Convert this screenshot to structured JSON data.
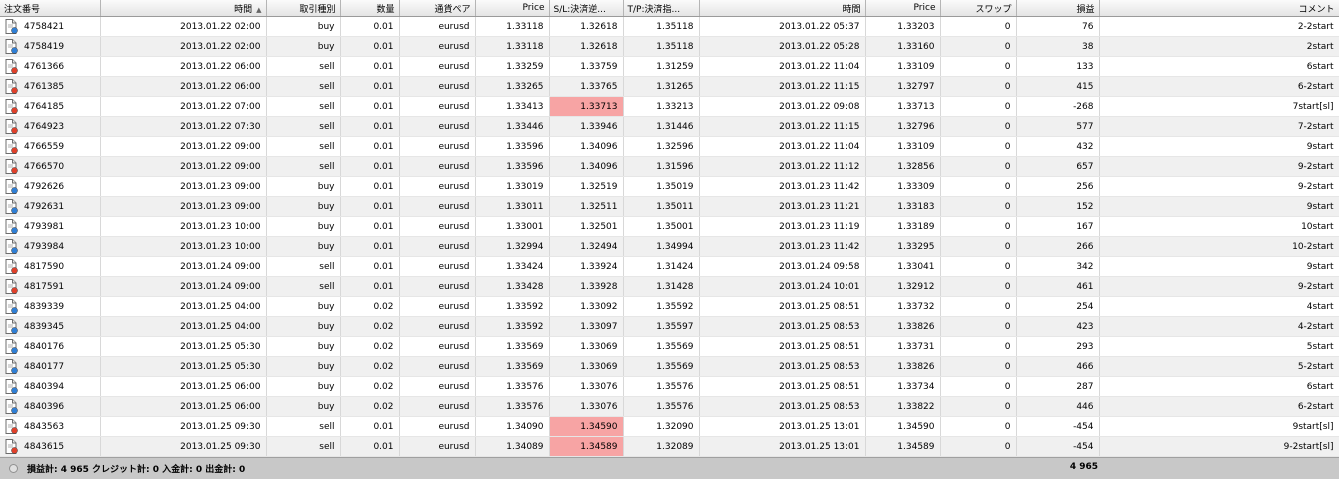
{
  "headers": {
    "order": "注文番号",
    "open_time": "時間",
    "type": "取引種別",
    "size": "数量",
    "pair": "通貨ペア",
    "open_price": "Price",
    "sl": "S/L:決済逆...",
    "tp": "T/P:決済指...",
    "close_time": "時間",
    "close_price": "Price",
    "swap": "スワップ",
    "profit": "損益",
    "comment": "コメント"
  },
  "rows": [
    {
      "order": "4758421",
      "open_time": "2013.01.22 02:00",
      "type": "buy",
      "size": "0.01",
      "pair": "eurusd",
      "open_price": "1.33118",
      "sl": "1.32618",
      "tp": "1.35118",
      "close_time": "2013.01.22 05:37",
      "close_price": "1.33203",
      "swap": "0",
      "profit": "76",
      "comment": "2-2start",
      "sl_hit": false
    },
    {
      "order": "4758419",
      "open_time": "2013.01.22 02:00",
      "type": "buy",
      "size": "0.01",
      "pair": "eurusd",
      "open_price": "1.33118",
      "sl": "1.32618",
      "tp": "1.35118",
      "close_time": "2013.01.22 05:28",
      "close_price": "1.33160",
      "swap": "0",
      "profit": "38",
      "comment": "2start",
      "sl_hit": false
    },
    {
      "order": "4761366",
      "open_time": "2013.01.22 06:00",
      "type": "sell",
      "size": "0.01",
      "pair": "eurusd",
      "open_price": "1.33259",
      "sl": "1.33759",
      "tp": "1.31259",
      "close_time": "2013.01.22 11:04",
      "close_price": "1.33109",
      "swap": "0",
      "profit": "133",
      "comment": "6start",
      "sl_hit": false
    },
    {
      "order": "4761385",
      "open_time": "2013.01.22 06:00",
      "type": "sell",
      "size": "0.01",
      "pair": "eurusd",
      "open_price": "1.33265",
      "sl": "1.33765",
      "tp": "1.31265",
      "close_time": "2013.01.22 11:15",
      "close_price": "1.32797",
      "swap": "0",
      "profit": "415",
      "comment": "6-2start",
      "sl_hit": false
    },
    {
      "order": "4764185",
      "open_time": "2013.01.22 07:00",
      "type": "sell",
      "size": "0.01",
      "pair": "eurusd",
      "open_price": "1.33413",
      "sl": "1.33713",
      "tp": "1.33213",
      "close_time": "2013.01.22 09:08",
      "close_price": "1.33713",
      "swap": "0",
      "profit": "-268",
      "comment": "7start[sl]",
      "sl_hit": true
    },
    {
      "order": "4764923",
      "open_time": "2013.01.22 07:30",
      "type": "sell",
      "size": "0.01",
      "pair": "eurusd",
      "open_price": "1.33446",
      "sl": "1.33946",
      "tp": "1.31446",
      "close_time": "2013.01.22 11:15",
      "close_price": "1.32796",
      "swap": "0",
      "profit": "577",
      "comment": "7-2start",
      "sl_hit": false
    },
    {
      "order": "4766559",
      "open_time": "2013.01.22 09:00",
      "type": "sell",
      "size": "0.01",
      "pair": "eurusd",
      "open_price": "1.33596",
      "sl": "1.34096",
      "tp": "1.32596",
      "close_time": "2013.01.22 11:04",
      "close_price": "1.33109",
      "swap": "0",
      "profit": "432",
      "comment": "9start",
      "sl_hit": false
    },
    {
      "order": "4766570",
      "open_time": "2013.01.22 09:00",
      "type": "sell",
      "size": "0.01",
      "pair": "eurusd",
      "open_price": "1.33596",
      "sl": "1.34096",
      "tp": "1.31596",
      "close_time": "2013.01.22 11:12",
      "close_price": "1.32856",
      "swap": "0",
      "profit": "657",
      "comment": "9-2start",
      "sl_hit": false
    },
    {
      "order": "4792626",
      "open_time": "2013.01.23 09:00",
      "type": "buy",
      "size": "0.01",
      "pair": "eurusd",
      "open_price": "1.33019",
      "sl": "1.32519",
      "tp": "1.35019",
      "close_time": "2013.01.23 11:42",
      "close_price": "1.33309",
      "swap": "0",
      "profit": "256",
      "comment": "9-2start",
      "sl_hit": false
    },
    {
      "order": "4792631",
      "open_time": "2013.01.23 09:00",
      "type": "buy",
      "size": "0.01",
      "pair": "eurusd",
      "open_price": "1.33011",
      "sl": "1.32511",
      "tp": "1.35011",
      "close_time": "2013.01.23 11:21",
      "close_price": "1.33183",
      "swap": "0",
      "profit": "152",
      "comment": "9start",
      "sl_hit": false
    },
    {
      "order": "4793981",
      "open_time": "2013.01.23 10:00",
      "type": "buy",
      "size": "0.01",
      "pair": "eurusd",
      "open_price": "1.33001",
      "sl": "1.32501",
      "tp": "1.35001",
      "close_time": "2013.01.23 11:19",
      "close_price": "1.33189",
      "swap": "0",
      "profit": "167",
      "comment": "10start",
      "sl_hit": false
    },
    {
      "order": "4793984",
      "open_time": "2013.01.23 10:00",
      "type": "buy",
      "size": "0.01",
      "pair": "eurusd",
      "open_price": "1.32994",
      "sl": "1.32494",
      "tp": "1.34994",
      "close_time": "2013.01.23 11:42",
      "close_price": "1.33295",
      "swap": "0",
      "profit": "266",
      "comment": "10-2start",
      "sl_hit": false
    },
    {
      "order": "4817590",
      "open_time": "2013.01.24 09:00",
      "type": "sell",
      "size": "0.01",
      "pair": "eurusd",
      "open_price": "1.33424",
      "sl": "1.33924",
      "tp": "1.31424",
      "close_time": "2013.01.24 09:58",
      "close_price": "1.33041",
      "swap": "0",
      "profit": "342",
      "comment": "9start",
      "sl_hit": false
    },
    {
      "order": "4817591",
      "open_time": "2013.01.24 09:00",
      "type": "sell",
      "size": "0.01",
      "pair": "eurusd",
      "open_price": "1.33428",
      "sl": "1.33928",
      "tp": "1.31428",
      "close_time": "2013.01.24 10:01",
      "close_price": "1.32912",
      "swap": "0",
      "profit": "461",
      "comment": "9-2start",
      "sl_hit": false
    },
    {
      "order": "4839339",
      "open_time": "2013.01.25 04:00",
      "type": "buy",
      "size": "0.02",
      "pair": "eurusd",
      "open_price": "1.33592",
      "sl": "1.33092",
      "tp": "1.35592",
      "close_time": "2013.01.25 08:51",
      "close_price": "1.33732",
      "swap": "0",
      "profit": "254",
      "comment": "4start",
      "sl_hit": false
    },
    {
      "order": "4839345",
      "open_time": "2013.01.25 04:00",
      "type": "buy",
      "size": "0.02",
      "pair": "eurusd",
      "open_price": "1.33592",
      "sl": "1.33097",
      "tp": "1.35597",
      "close_time": "2013.01.25 08:53",
      "close_price": "1.33826",
      "swap": "0",
      "profit": "423",
      "comment": "4-2start",
      "sl_hit": false
    },
    {
      "order": "4840176",
      "open_time": "2013.01.25 05:30",
      "type": "buy",
      "size": "0.02",
      "pair": "eurusd",
      "open_price": "1.33569",
      "sl": "1.33069",
      "tp": "1.35569",
      "close_time": "2013.01.25 08:51",
      "close_price": "1.33731",
      "swap": "0",
      "profit": "293",
      "comment": "5start",
      "sl_hit": false
    },
    {
      "order": "4840177",
      "open_time": "2013.01.25 05:30",
      "type": "buy",
      "size": "0.02",
      "pair": "eurusd",
      "open_price": "1.33569",
      "sl": "1.33069",
      "tp": "1.35569",
      "close_time": "2013.01.25 08:53",
      "close_price": "1.33826",
      "swap": "0",
      "profit": "466",
      "comment": "5-2start",
      "sl_hit": false
    },
    {
      "order": "4840394",
      "open_time": "2013.01.25 06:00",
      "type": "buy",
      "size": "0.02",
      "pair": "eurusd",
      "open_price": "1.33576",
      "sl": "1.33076",
      "tp": "1.35576",
      "close_time": "2013.01.25 08:51",
      "close_price": "1.33734",
      "swap": "0",
      "profit": "287",
      "comment": "6start",
      "sl_hit": false
    },
    {
      "order": "4840396",
      "open_time": "2013.01.25 06:00",
      "type": "buy",
      "size": "0.02",
      "pair": "eurusd",
      "open_price": "1.33576",
      "sl": "1.33076",
      "tp": "1.35576",
      "close_time": "2013.01.25 08:53",
      "close_price": "1.33822",
      "swap": "0",
      "profit": "446",
      "comment": "6-2start",
      "sl_hit": false
    },
    {
      "order": "4843563",
      "open_time": "2013.01.25 09:30",
      "type": "sell",
      "size": "0.01",
      "pair": "eurusd",
      "open_price": "1.34090",
      "sl": "1.34590",
      "tp": "1.32090",
      "close_time": "2013.01.25 13:01",
      "close_price": "1.34590",
      "swap": "0",
      "profit": "-454",
      "comment": "9start[sl]",
      "sl_hit": true
    },
    {
      "order": "4843615",
      "open_time": "2013.01.25 09:30",
      "type": "sell",
      "size": "0.01",
      "pair": "eurusd",
      "open_price": "1.34089",
      "sl": "1.34589",
      "tp": "1.32089",
      "close_time": "2013.01.25 13:01",
      "close_price": "1.34589",
      "swap": "0",
      "profit": "-454",
      "comment": "9-2start[sl]",
      "sl_hit": true
    }
  ],
  "footer": {
    "summary": "損益計: 4 965  クレジット計: 0  入金計: 0  出金計: 0",
    "total_profit": "4 965"
  },
  "colors": {
    "sl_hit_bg": "#f7a4a4",
    "buy_dot": "#2f7fd6",
    "sell_dot": "#e0402a"
  },
  "icons": {
    "buy": "document-blue-dot-icon",
    "sell": "document-red-dot-icon",
    "footer": "status-dot-icon"
  }
}
